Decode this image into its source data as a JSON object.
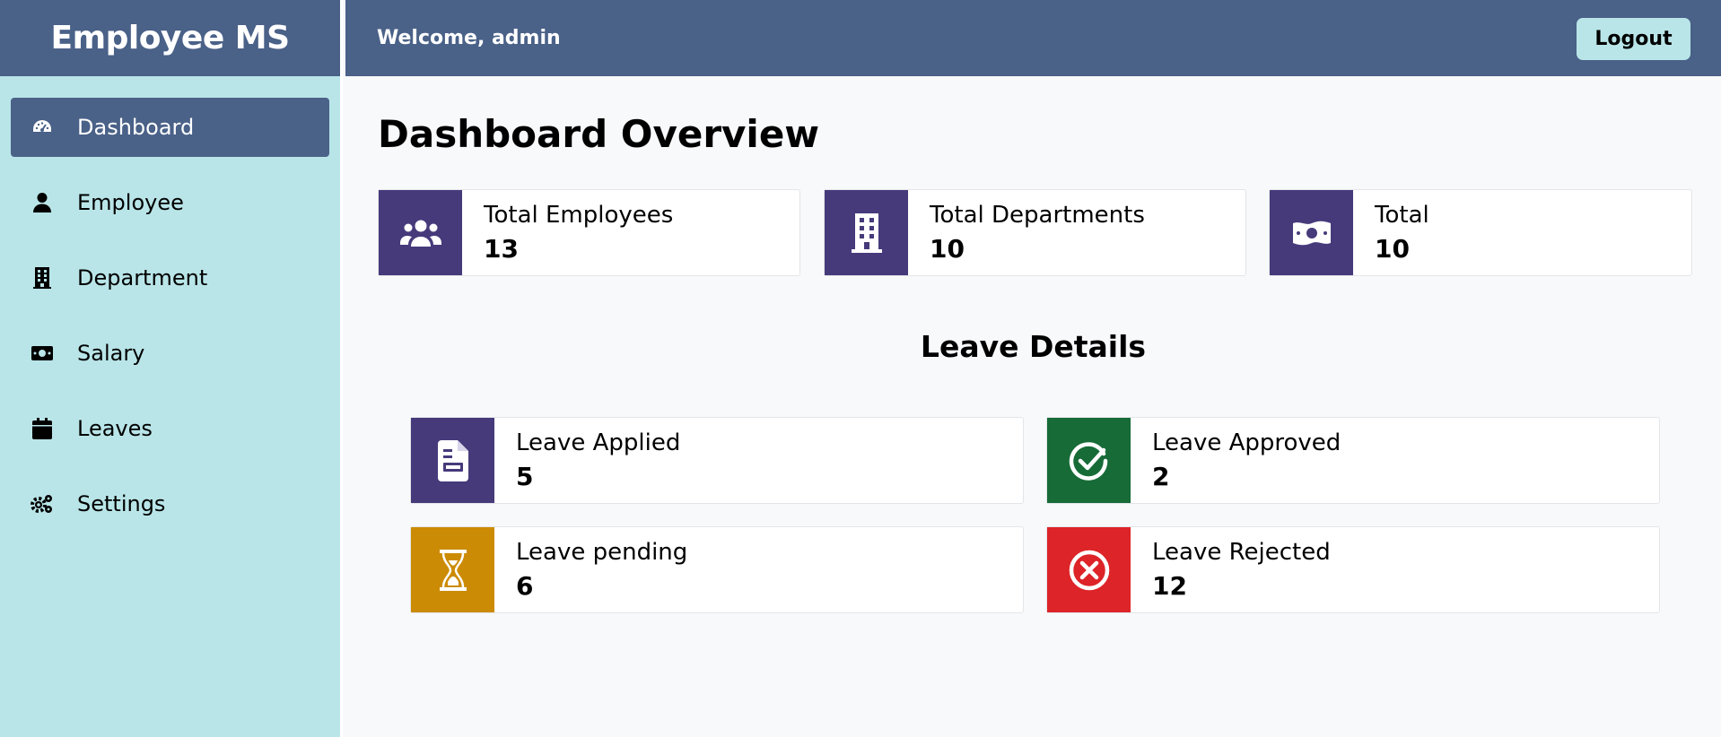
{
  "brand": {
    "name": "Employee MS"
  },
  "header": {
    "welcome": "Welcome, admin",
    "logout_label": "Logout"
  },
  "sidebar": {
    "items": [
      {
        "label": "Dashboard",
        "icon": "dashboard-icon",
        "active": true
      },
      {
        "label": "Employee",
        "icon": "user-icon"
      },
      {
        "label": "Department",
        "icon": "building-icon"
      },
      {
        "label": "Salary",
        "icon": "money-bill-icon"
      },
      {
        "label": "Leaves",
        "icon": "calendar-icon"
      },
      {
        "label": "Settings",
        "icon": "gears-icon"
      }
    ]
  },
  "main": {
    "title": "Dashboard Overview",
    "summary_cards": [
      {
        "label": "Total Employees",
        "value": "13",
        "icon": "users-icon",
        "color": "#463a7b"
      },
      {
        "label": "Total Departments",
        "value": "10",
        "icon": "building-icon",
        "color": "#463a7b"
      },
      {
        "label": "Total",
        "value": "10",
        "icon": "money-bill-icon",
        "color": "#463a7b"
      }
    ],
    "leave_section_title": "Leave Details",
    "leave_cards": [
      {
        "label": "Leave Applied",
        "value": "5",
        "icon": "file-icon",
        "color": "#463a7b"
      },
      {
        "label": "Leave Approved",
        "value": "2",
        "icon": "check-circle-icon",
        "color": "#176b37"
      },
      {
        "label": "Leave pending",
        "value": "6",
        "icon": "hourglass-icon",
        "color": "#cc8b04"
      },
      {
        "label": "Leave Rejected",
        "value": "12",
        "icon": "x-circle-icon",
        "color": "#dd2428"
      }
    ]
  }
}
